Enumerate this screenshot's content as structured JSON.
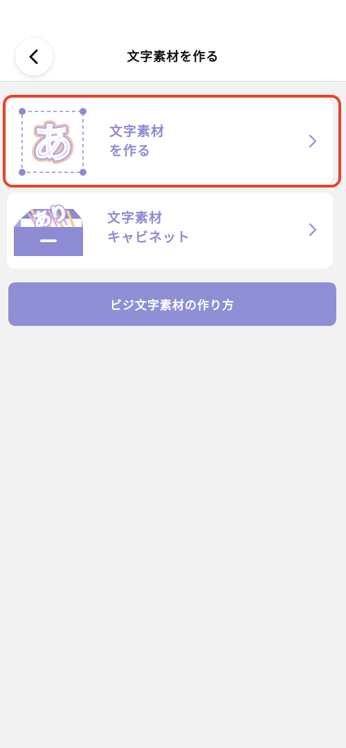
{
  "header": {
    "title": "文字素材を作る",
    "back_icon": "chevron-left-icon"
  },
  "cards": [
    {
      "line1": "文字素材",
      "line2": "を作る",
      "illustration_glyph": "あ",
      "icon": "chevron-right-icon",
      "highlighted": true
    },
    {
      "line1": "文字素材",
      "line2": "キャビネット",
      "illustration_glyph": "あり",
      "icon": "chevron-right-icon"
    }
  ],
  "howto_button": {
    "label": "ビジ文字素材の作り方"
  },
  "colors": {
    "accent": "#8d8bd3",
    "button": "#8f8fd6",
    "highlight": "#e8432b",
    "background": "#f2f2f2"
  }
}
